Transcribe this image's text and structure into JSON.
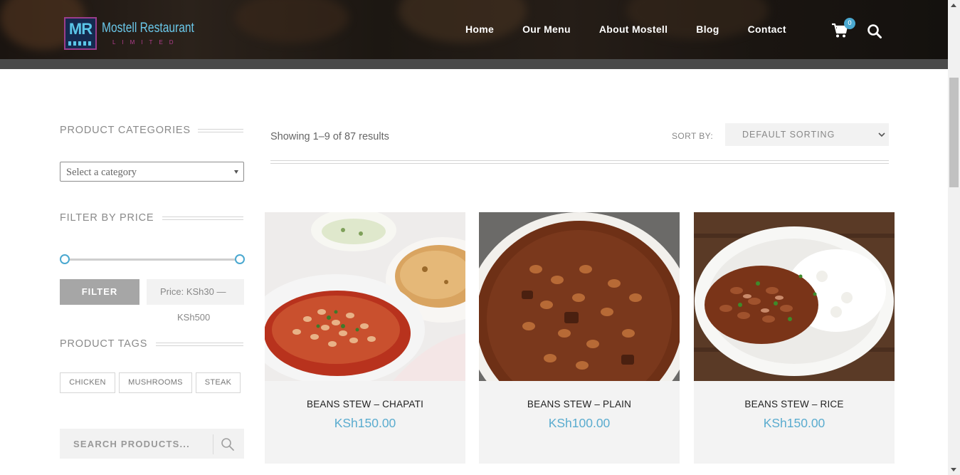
{
  "brand": {
    "logo_mark": "MR",
    "name": "Mostell Restaurant",
    "tagline": "LIMITED"
  },
  "nav": {
    "items": [
      "Home",
      "Our Menu",
      "About Mostell",
      "Blog",
      "Contact"
    ],
    "cart_count": "0",
    "icons": [
      "cart-icon",
      "search-icon"
    ]
  },
  "sidebar": {
    "categories": {
      "title": "PRODUCT CATEGORIES",
      "select_placeholder": "Select a category"
    },
    "price_filter": {
      "title": "FILTER BY PRICE",
      "button_label": "FILTER",
      "price_label_line1": "Price: KSh30 —",
      "price_label_line2": "KSh500",
      "min_fraction": 0,
      "max_fraction": 1
    },
    "tags": {
      "title": "PRODUCT TAGS",
      "items": [
        "CHICKEN",
        "MUSHROOMS",
        "STEAK"
      ]
    },
    "search": {
      "placeholder": "SEARCH PRODUCTS..."
    }
  },
  "main": {
    "results_text": "Showing 1–9 of 87 results",
    "sort_label": "SORT BY:",
    "sort_value": "DEFAULT SORTING",
    "products": [
      {
        "name": "BEANS STEW – CHAPATI",
        "price": "KSh150.00"
      },
      {
        "name": "BEANS STEW – PLAIN",
        "price": "KSh100.00"
      },
      {
        "name": "BEANS STEW – RICE",
        "price": "KSh150.00"
      }
    ]
  },
  "colors": {
    "accent": "#4aa8d0",
    "price": "#5aaccf",
    "header_bg": "#1c1712",
    "filter_button": "#a6a6a6"
  }
}
